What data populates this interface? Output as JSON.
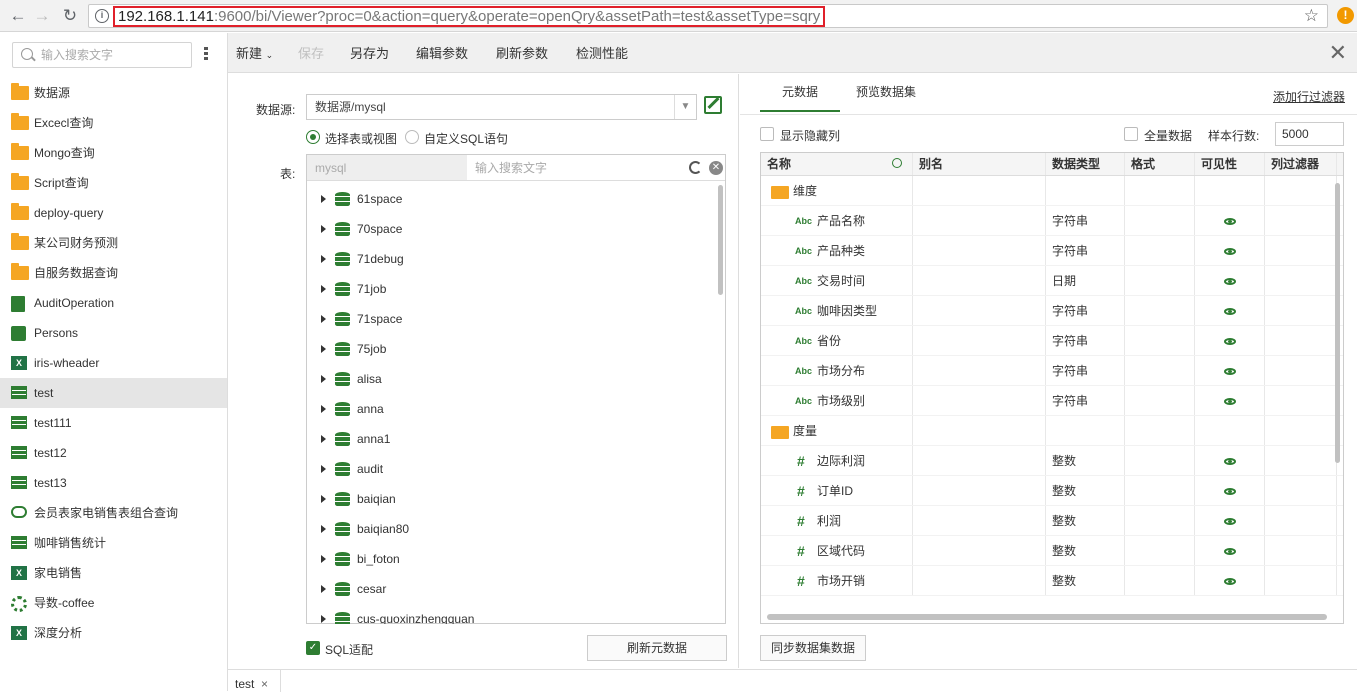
{
  "browser": {
    "url_host": "192.168.1.141",
    "url_rest": ":9600/bi/Viewer?proc=0&action=query&operate=openQry&assetPath=test&assetType=sqry",
    "back_icon": "back-arrow-icon",
    "forward_icon": "forward-arrow-icon",
    "reload_icon": "reload-icon",
    "bookmark_icon": "star-icon",
    "warning_icon": "warning-icon"
  },
  "sidebar": {
    "search_placeholder": "输入搜索文字",
    "items": [
      {
        "label": "数据源",
        "icon": "folder-icon"
      },
      {
        "label": "Excecl查询",
        "icon": "folder-icon"
      },
      {
        "label": "Mongo查询",
        "icon": "folder-icon"
      },
      {
        "label": "Script查询",
        "icon": "folder-icon"
      },
      {
        "label": "deploy-query",
        "icon": "folder-icon"
      },
      {
        "label": "某公司财务预测",
        "icon": "folder-icon"
      },
      {
        "label": "自服务数据查询",
        "icon": "folder-icon"
      },
      {
        "label": "AuditOperation",
        "icon": "audit-icon"
      },
      {
        "label": "Persons",
        "icon": "puzzle-icon"
      },
      {
        "label": "iris-wheader",
        "icon": "excel-icon"
      },
      {
        "label": "test",
        "icon": "table-icon"
      },
      {
        "label": "test111",
        "icon": "table-icon"
      },
      {
        "label": "test12",
        "icon": "table-icon"
      },
      {
        "label": "test13",
        "icon": "table-icon"
      },
      {
        "label": "会员表家电销售表组合查询",
        "icon": "combo-icon"
      },
      {
        "label": "咖啡销售统计",
        "icon": "table-icon"
      },
      {
        "label": "家电销售",
        "icon": "excel-icon"
      },
      {
        "label": "导数-coffee",
        "icon": "gear-icon"
      },
      {
        "label": "深度分析",
        "icon": "excel-icon"
      }
    ],
    "active_index": 10
  },
  "toolbar": {
    "new": "新建",
    "save": "保存",
    "save_as": "另存为",
    "edit_params": "编辑参数",
    "refresh_params": "刷新参数",
    "check_perf": "检测性能"
  },
  "left_pane": {
    "datasource_label": "数据源:",
    "datasource_value": "数据源/mysql",
    "radio_select_table": "选择表或视图",
    "radio_custom_sql": "自定义SQL语句",
    "table_label": "表:",
    "schema_value": "mysql",
    "table_search_placeholder": "输入搜索文字",
    "tree_items": [
      "61space",
      "70space",
      "71debug",
      "71job",
      "71space",
      "75job",
      "alisa",
      "anna",
      "anna1",
      "audit",
      "baiqian",
      "baiqian80",
      "bi_foton",
      "cesar",
      "cus-guoxinzhengquan"
    ],
    "sql_adapt_label": "SQL适配",
    "refresh_meta_button": "刷新元数据"
  },
  "right_pane": {
    "tab_metadata": "元数据",
    "tab_preview": "预览数据集",
    "add_row_filter": "添加行过滤器",
    "show_hidden_cols": "显示隐藏列",
    "full_data": "全量数据",
    "sample_rows_label": "样本行数:",
    "sample_rows_value": "5000",
    "columns": {
      "name": "名称",
      "alias": "别名",
      "type": "数据类型",
      "format": "格式",
      "visible": "可见性",
      "filter": "列过滤器"
    },
    "groups": [
      {
        "name": "维度",
        "fields": [
          {
            "name": "产品名称",
            "type": "字符串",
            "kind": "Abc"
          },
          {
            "name": "产品种类",
            "type": "字符串",
            "kind": "Abc"
          },
          {
            "name": "交易时间",
            "type": "日期",
            "kind": "Abc"
          },
          {
            "name": "咖啡因类型",
            "type": "字符串",
            "kind": "Abc"
          },
          {
            "name": "省份",
            "type": "字符串",
            "kind": "Abc"
          },
          {
            "name": "市场分布",
            "type": "字符串",
            "kind": "Abc"
          },
          {
            "name": "市场级别",
            "type": "字符串",
            "kind": "Abc"
          }
        ]
      },
      {
        "name": "度量",
        "fields": [
          {
            "name": "边际利润",
            "type": "整数",
            "kind": "#"
          },
          {
            "name": "订单ID",
            "type": "整数",
            "kind": "#"
          },
          {
            "name": "利润",
            "type": "整数",
            "kind": "#"
          },
          {
            "name": "区域代码",
            "type": "整数",
            "kind": "#"
          },
          {
            "name": "市场开销",
            "type": "整数",
            "kind": "#"
          }
        ]
      }
    ],
    "sync_button": "同步数据集数据"
  },
  "bottom": {
    "tab_label": "test",
    "tab_close": "×"
  }
}
